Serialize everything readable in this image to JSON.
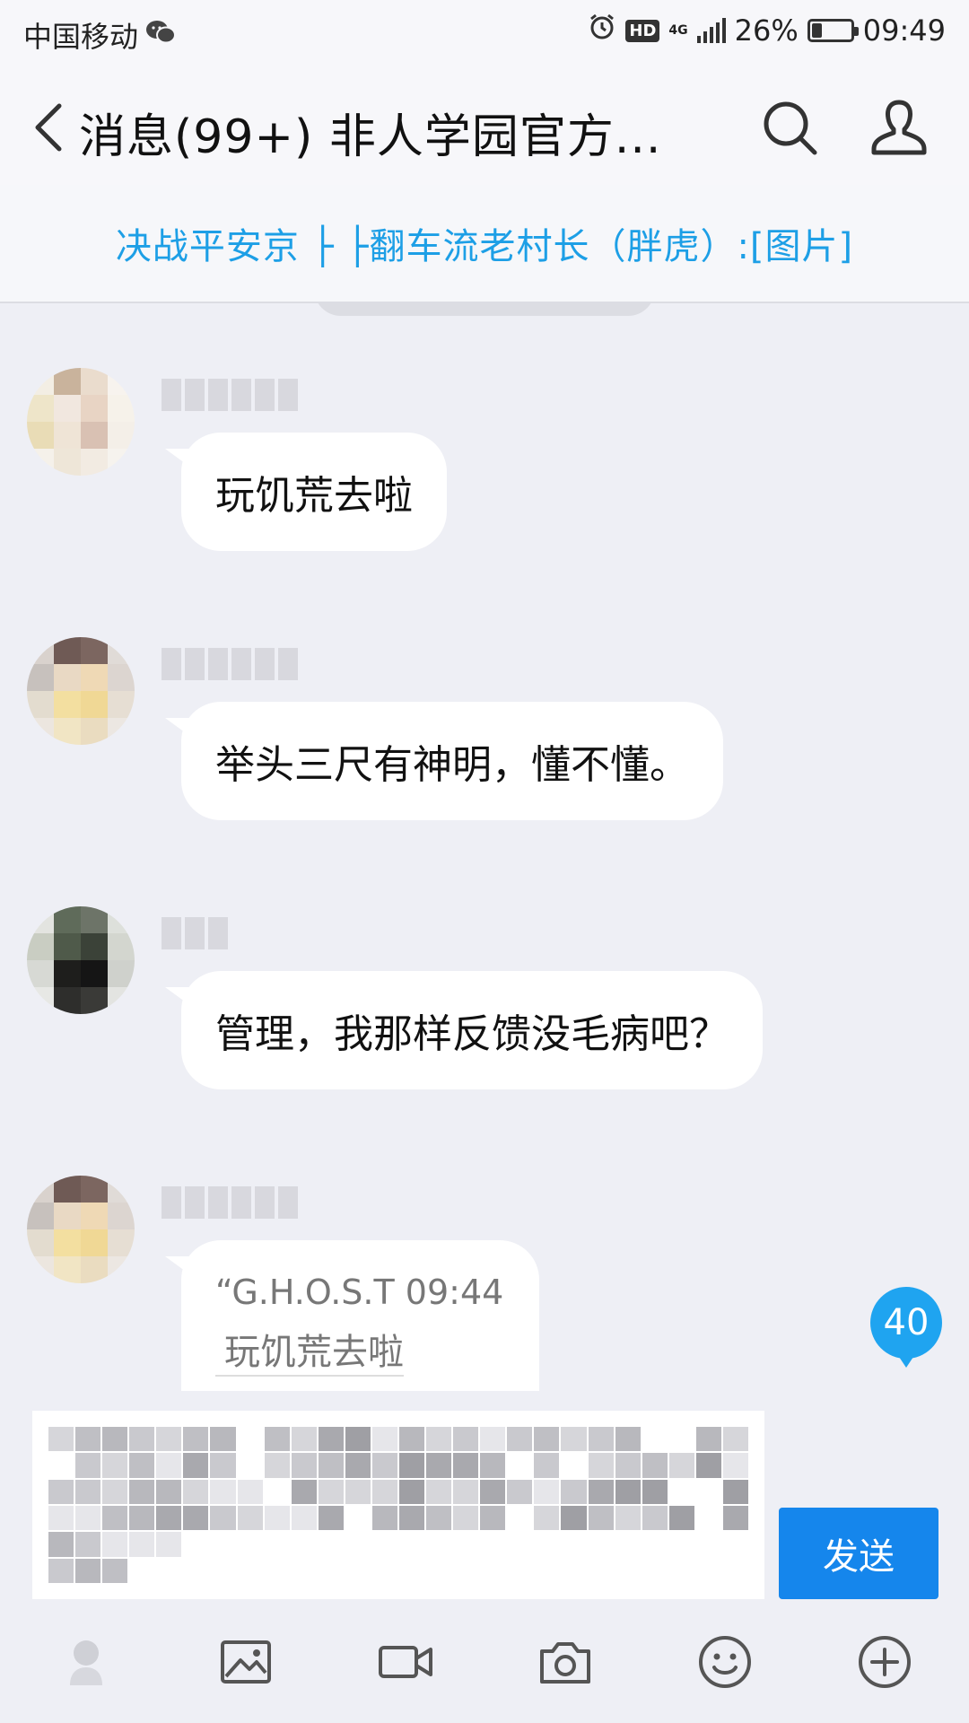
{
  "status_bar": {
    "carrier": "中国移动",
    "network": "4G",
    "battery": "26%",
    "battery_level": 0.26,
    "time": "09:49",
    "icons": [
      "wechat-icon",
      "alarm-icon",
      "hd-icon",
      "signal-icon",
      "battery-icon"
    ]
  },
  "header": {
    "title": "消息(99+)  非人学园官方...",
    "icons": [
      "back-arrow-icon",
      "search-icon",
      "group-members-icon"
    ]
  },
  "notice": {
    "text": "决战平安京 ├ ├翻车流老村长（胖虎）:[图片]"
  },
  "messages": [
    {
      "text": "玩饥荒去啦"
    },
    {
      "text": "举头三尺有神明，懂不懂。"
    },
    {
      "text": "管理，我那样反馈没毛病吧？"
    },
    {
      "quote_meta": "“G.H.O.S.T 09:44",
      "quote_text": "玩饥荒去啦"
    }
  ],
  "unread_badge": "40",
  "input": {
    "send_label": "发送"
  },
  "toolbar_icons": [
    "voice-icon",
    "image-icon",
    "video-icon",
    "camera-icon",
    "emoji-icon",
    "plus-icon"
  ],
  "colors": {
    "accent": "#1586ec",
    "notice_text": "#1d9fe6",
    "badge": "#1fa4f0",
    "background": "#eeeff5"
  }
}
